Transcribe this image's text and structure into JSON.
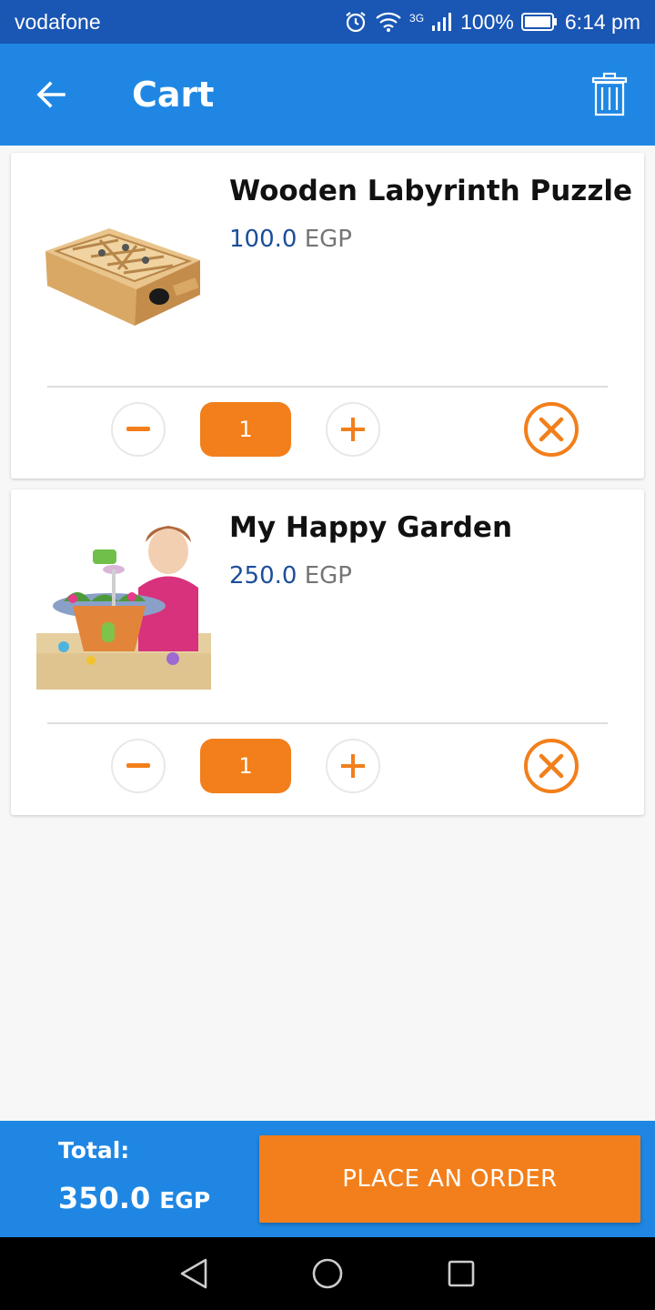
{
  "status_bar": {
    "carrier": "vodafone",
    "network": "3G",
    "battery": "100%",
    "time": "6:14 pm"
  },
  "app_bar": {
    "title": "Cart",
    "back_icon": "arrow-left-icon",
    "trash_icon": "trash-icon"
  },
  "cart": {
    "items": [
      {
        "name": "Wooden Labyrinth Puzzle",
        "price": "100.0",
        "currency": "EGP",
        "quantity": "1"
      },
      {
        "name": "My Happy Garden",
        "price": "250.0",
        "currency": "EGP",
        "quantity": "1"
      }
    ]
  },
  "footer": {
    "total_label": "Total:",
    "total_value": "350.0",
    "total_currency": "EGP",
    "order_button": "PLACE AN ORDER"
  },
  "colors": {
    "primary": "#1f87e3",
    "status_bar": "#1a56b4",
    "accent": "#f27f1b",
    "price": "#1c4e9a"
  }
}
